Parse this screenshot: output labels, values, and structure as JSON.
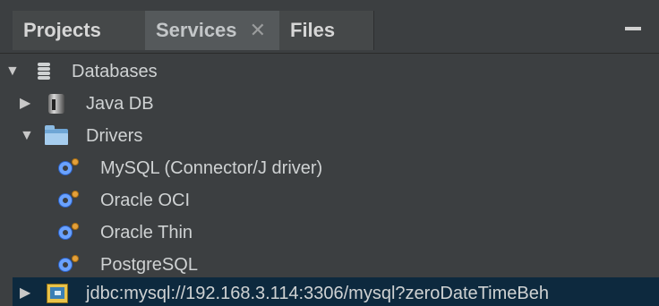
{
  "tabs": [
    {
      "label": "Projects"
    },
    {
      "label": "Services",
      "close": "✕"
    },
    {
      "label": "Files"
    }
  ],
  "tree": [
    {
      "label": "Databases",
      "expanded": true,
      "icon": "database-icon"
    },
    {
      "label": "Java DB",
      "expanded": false,
      "icon": "java-db-icon"
    },
    {
      "label": "Drivers",
      "expanded": true,
      "icon": "folder-icon"
    },
    {
      "label": "MySQL (Connector/J driver)",
      "icon": "driver-icon"
    },
    {
      "label": "Oracle OCI",
      "icon": "driver-icon"
    },
    {
      "label": "Oracle Thin",
      "icon": "driver-icon"
    },
    {
      "label": "PostgreSQL",
      "icon": "driver-icon"
    },
    {
      "label": "jdbc:mysql://192.168.3.114:3306/mysql?zeroDateTimeBeh",
      "expanded": false,
      "icon": "connection-icon",
      "selected": true
    }
  ],
  "glyphs": {
    "expanded": "▼",
    "collapsed": "▶"
  },
  "colors": {
    "panel": "#3c3f41",
    "selection": "#0d293e",
    "text": "#cfd2d3"
  }
}
